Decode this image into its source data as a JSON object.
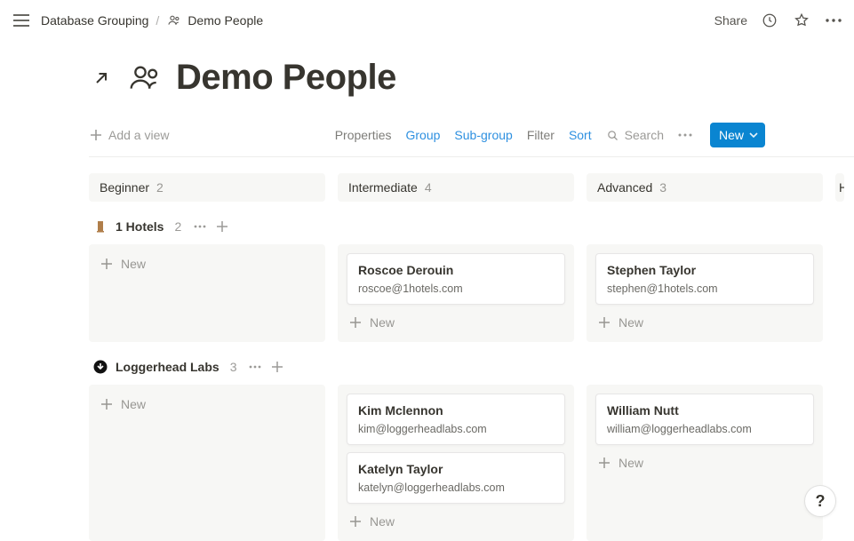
{
  "topbar": {
    "crumb1": "Database Grouping",
    "crumb2": "Demo People",
    "share": "Share"
  },
  "page": {
    "title": "Demo People",
    "add_view": "Add a view"
  },
  "controls": {
    "properties": "Properties",
    "group": "Group",
    "subgroup": "Sub-group",
    "filter": "Filter",
    "sort": "Sort",
    "search": "Search",
    "new": "New"
  },
  "columns": [
    {
      "name": "Beginner",
      "count": "2"
    },
    {
      "name": "Intermediate",
      "count": "4"
    },
    {
      "name": "Advanced",
      "count": "3"
    },
    {
      "name": "H",
      "count": ""
    }
  ],
  "groups": [
    {
      "name": "1 Hotels",
      "count": "2",
      "icon": "hotel",
      "cols": [
        {
          "new_label": "New"
        },
        {
          "new_label": "New",
          "cards": [
            {
              "name": "Roscoe Derouin",
              "email": "roscoe@1hotels.com"
            }
          ]
        },
        {
          "new_label": "New",
          "cards": [
            {
              "name": "Stephen Taylor",
              "email": "stephen@1hotels.com"
            }
          ]
        }
      ]
    },
    {
      "name": "Loggerhead Labs",
      "count": "3",
      "icon": "circle",
      "cols": [
        {
          "new_label": "New"
        },
        {
          "new_label": "New",
          "cards": [
            {
              "name": "Kim Mclennon",
              "email": "kim@loggerheadlabs.com"
            },
            {
              "name": "Katelyn Taylor",
              "email": "katelyn@loggerheadlabs.com"
            }
          ]
        },
        {
          "new_label": "New",
          "cards": [
            {
              "name": "William Nutt",
              "email": "william@loggerheadlabs.com"
            }
          ]
        }
      ]
    }
  ],
  "help": "?"
}
